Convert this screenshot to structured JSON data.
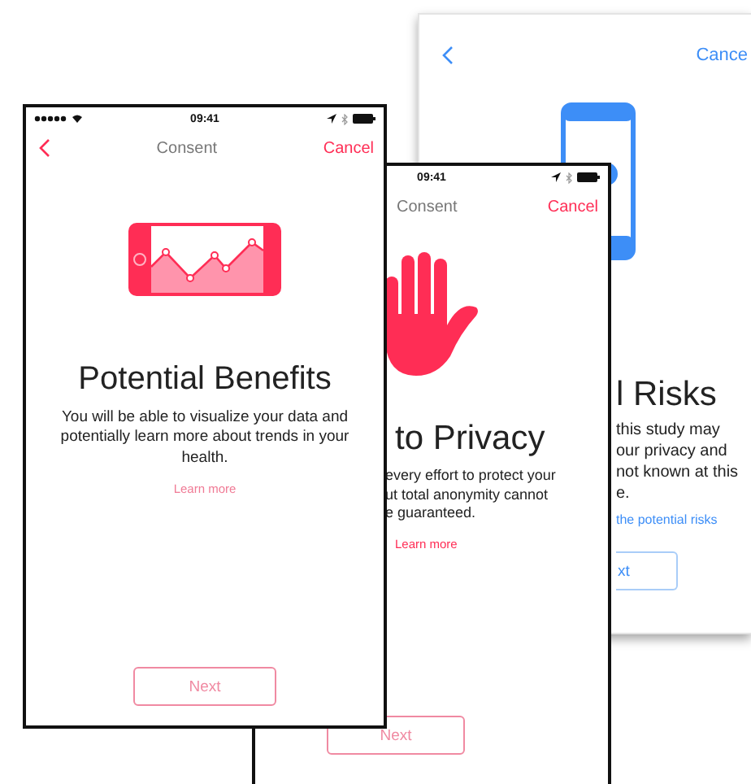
{
  "back_screen": {
    "nav": {
      "cancel": "Cance"
    },
    "title": "l Risks",
    "body_lines": [
      "this study may",
      "our privacy and",
      "not known at this",
      "e."
    ],
    "link": "the potential risks",
    "button": "xt"
  },
  "middle_screen": {
    "status": {
      "time": "09:41"
    },
    "nav": {
      "title": "Consent",
      "cancel": "Cancel"
    },
    "title": "to Privacy",
    "body_lines": [
      "every effort to protect your",
      "ut total anonymity cannot",
      "e guaranteed."
    ],
    "link": "Learn more",
    "button": "Next"
  },
  "front_screen": {
    "status": {
      "time": "09:41"
    },
    "nav": {
      "title": "Consent",
      "cancel": "Cancel"
    },
    "title": "Potential Benefits",
    "body": "You will be able to visualize your data and potentially learn more about trends in your health.",
    "link": "Learn more",
    "button": "Next"
  }
}
